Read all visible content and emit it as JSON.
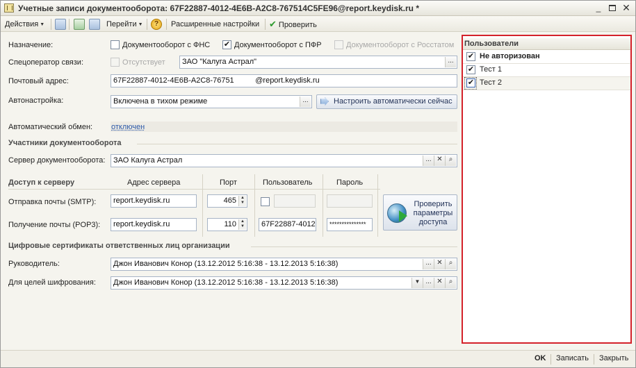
{
  "window": {
    "title": "Учетные записи документооборота: 67F22887-4012-4E6B-A2C8-767514C5FE96@report.keydisk.ru *",
    "minimize_glyph": "_",
    "close_glyph": "✕"
  },
  "toolbar": {
    "actions_label": "Действия",
    "goto_label": "Перейти",
    "advanced_label": "Расширенные настройки",
    "check_label": "Проверить",
    "help_glyph": "?"
  },
  "form": {
    "purpose_label": "Назначение:",
    "purpose_fns": {
      "label": "Документооборот с ФНС",
      "checked": false
    },
    "purpose_pfr": {
      "label": "Документооборот с ПФР",
      "checked": true
    },
    "purpose_rosstat": {
      "label": "Документооборот с Росстатом",
      "checked": false
    },
    "operator_label": "Спецоператор связи:",
    "operator_absent_label": "Отсутствует",
    "operator_value": "ЗАО \"Калуга Астрал\"",
    "email_label": "Почтовый адрес:",
    "email_value": "67F22887-4012-4E6B-A2C8-76751          @report.keydisk.ru",
    "autosetup_label": "Автонастройка:",
    "autosetup_value": "Включена в тихом режиме",
    "autosetup_button": "Настроить автоматически сейчас",
    "autoexchange_label": "Автоматический обмен:",
    "autoexchange_value": "отключен",
    "participants_header": "Участники документооборота",
    "server_label": "Сервер документооборота:",
    "server_value": "ЗАО Калуга Астрал",
    "access_header": "Доступ к серверу",
    "col_address": "Адрес сервера",
    "col_port": "Порт",
    "col_user": "Пользователь",
    "col_password": "Пароль",
    "smtp_label": "Отправка почты (SMTP):",
    "smtp_address": "report.keydisk.ru",
    "smtp_port": "465",
    "pop3_label": "Получение почты (POP3):",
    "pop3_address": "report.keydisk.ru",
    "pop3_port": "110",
    "pop3_user": "67F22887-4012",
    "pop3_password": "***************",
    "check_params_button": "Проверить параметры доступа",
    "certs_header": "Цифровые сертификаты ответственных лиц организации",
    "head_label": "Руководитель:",
    "head_value": "Джон Иванович Конор (13.12.2012 5:16:38 - 13.12.2013 5:16:38)",
    "encrypt_label": "Для целей шифрования:",
    "encrypt_value": "Джон Иванович Конор (13.12.2012 5:16:38 - 13.12.2013 5:16:38)"
  },
  "users_panel": {
    "header": "Пользователи",
    "items": [
      {
        "label": "Не авторизован",
        "checked": true
      },
      {
        "label": "Тест 1",
        "checked": true
      },
      {
        "label": "Тест 2",
        "checked": true
      }
    ]
  },
  "statusbar": {
    "ok_label": "OK",
    "save_label": "Записать",
    "close_label": "Закрыть"
  },
  "colors": {
    "highlight_border": "#d4212a",
    "link": "#2b58a8"
  }
}
